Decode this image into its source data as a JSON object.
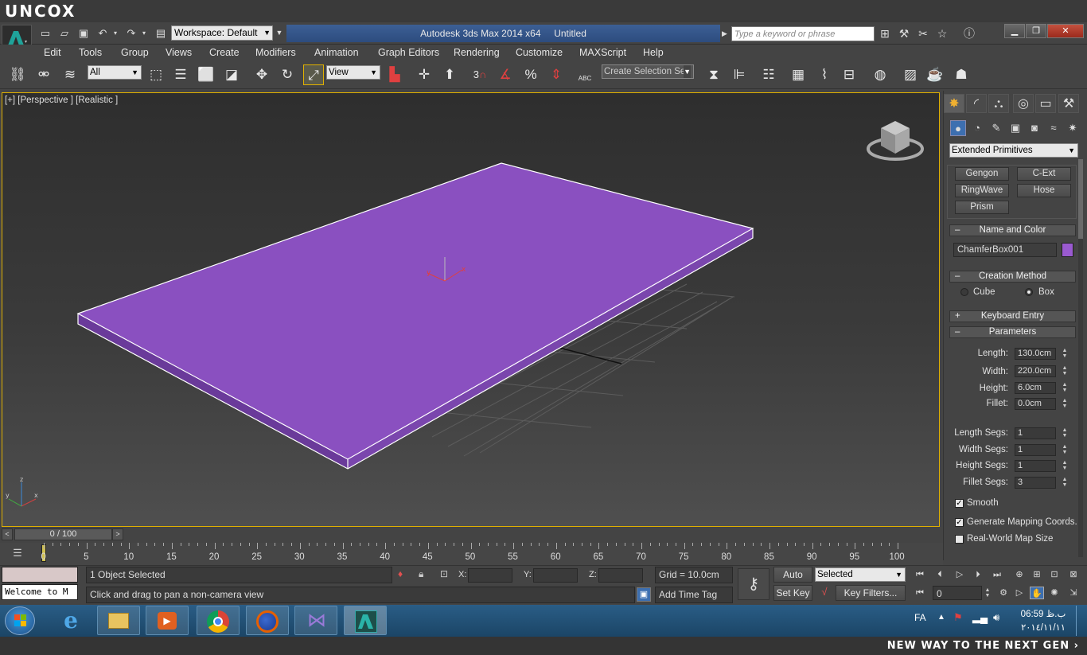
{
  "brand": "UNCOX",
  "title_bar": {
    "workspace": "Workspace: Default",
    "app_title": "Autodesk 3ds Max  2014 x64",
    "doc_title": "Untitled",
    "search_placeholder": "Type a keyword or phrase"
  },
  "menu": [
    "Edit",
    "Tools",
    "Group",
    "Views",
    "Create",
    "Modifiers",
    "Animation",
    "Graph Editors",
    "Rendering",
    "Customize",
    "MAXScript",
    "Help"
  ],
  "toolbar": {
    "filter": "All",
    "ref_coord": "View",
    "named_selection": "Create Selection Se",
    "snap_label": "3",
    "abc_label": "ABC"
  },
  "viewport": {
    "label": "[+] [Perspective ] [Realistic ]",
    "object_color": "#8a50c0"
  },
  "command_panel": {
    "category": "Extended Primitives",
    "buttons": [
      "Gengon",
      "C-Ext",
      "RingWave",
      "Hose",
      "Prism"
    ],
    "name_color": {
      "title": "Name and Color",
      "sign": "–",
      "name": "ChamferBox001",
      "color": "#9a5ad0"
    },
    "creation_method": {
      "title": "Creation Method",
      "sign": "–",
      "options": [
        "Cube",
        "Box"
      ],
      "selected": "Box"
    },
    "keyboard_entry": {
      "title": "Keyboard Entry",
      "sign": "+"
    },
    "parameters": {
      "title": "Parameters",
      "sign": "–",
      "length": {
        "label": "Length:",
        "value": "130.0cm"
      },
      "width": {
        "label": "Width:",
        "value": "220.0cm"
      },
      "height": {
        "label": "Height:",
        "value": "6.0cm"
      },
      "fillet": {
        "label": "Fillet:",
        "value": "0.0cm"
      },
      "length_segs": {
        "label": "Length Segs:",
        "value": "1"
      },
      "width_segs": {
        "label": "Width Segs:",
        "value": "1"
      },
      "height_segs": {
        "label": "Height Segs:",
        "value": "1"
      },
      "fillet_segs": {
        "label": "Fillet Segs:",
        "value": "3"
      },
      "smooth": {
        "label": "Smooth",
        "checked": true
      },
      "gen_mapping": {
        "label": "Generate Mapping Coords.",
        "checked": true
      },
      "real_world": {
        "label": "Real-World Map Size",
        "checked": false
      }
    }
  },
  "timeline": {
    "slider": "0 / 100",
    "ticks": [
      "0",
      "5",
      "10",
      "15",
      "20",
      "25",
      "30",
      "35",
      "40",
      "45",
      "50",
      "55",
      "60",
      "65",
      "70",
      "75",
      "80",
      "85",
      "90",
      "95",
      "100"
    ]
  },
  "status": {
    "maxscript": "Welcome to M",
    "selection": "1 Object Selected",
    "prompt": "Click and drag to pan a non-camera view",
    "x_label": "X:",
    "y_label": "Y:",
    "z_label": "Z:",
    "grid": "Grid = 10.0cm",
    "add_time_tag": "Add Time Tag",
    "auto_key": "Auto Key",
    "set_key": "Set Key",
    "key_mode": "Selected",
    "key_filters": "Key Filters...",
    "frame": "0"
  },
  "taskbar": {
    "lang": "FA",
    "time": "06:59 ب.ظ",
    "date": "٢٠١٤/١١/١١"
  },
  "slogan": "NEW WAY TO THE NEXT GEN"
}
